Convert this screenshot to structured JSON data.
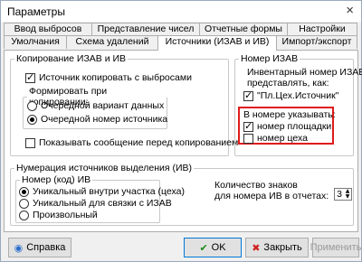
{
  "window": {
    "title": "Параметры",
    "close_icon": "×"
  },
  "tabs_row1": [
    "Ввод выбросов",
    "Представление чисел",
    "Отчетные формы",
    "Настройки"
  ],
  "tabs_row2": [
    "Умолчания",
    "Схема удалений",
    "Источники (ИЗАВ и ИВ)",
    "Импорт/экспорт"
  ],
  "active_tab": "Источники (ИЗАВ и ИВ)",
  "copy_group": {
    "legend": "Копирование ИЗАВ и ИВ",
    "copy_with_emissions": "Источник копировать с выбросами",
    "form_legend": "Формировать при копировании:",
    "radio_next_variant": "Очередной вариант данных",
    "radio_next_number": "Очередной номер источника",
    "show_message": "Показывать сообщение перед копированием"
  },
  "number_group": {
    "legend": "Номер ИЗАВ",
    "line1": "Инвентарный номер ИЗАВ",
    "line2": "представлять, как:",
    "format_option": "\"Пл.Цех.Источник\"",
    "specify_label": "В номере указывать:",
    "area_number": "номер площадки",
    "shop_number": "номер цеха"
  },
  "iv_group": {
    "legend": "Нумерация источников выделения (ИВ)",
    "inner_legend": "Номер (код)  ИВ",
    "radio_unique_area": "Уникальный внутри участка (цеха)",
    "radio_unique_link": "Уникальный для связки с ИЗАВ",
    "radio_arbitrary": "Произвольный",
    "digits_line1": "Количество знаков",
    "digits_line2": "для номера ИВ в отчетах:",
    "digits_value": "3"
  },
  "buttons": {
    "help": "Справка",
    "ok": "OK",
    "close": "Закрыть",
    "apply": "Применить"
  },
  "colors": {
    "highlight": "#e01a1a",
    "ok_check": "#1a8a1a",
    "close_x": "#d02020",
    "help_icon": "#2a6fc9"
  }
}
